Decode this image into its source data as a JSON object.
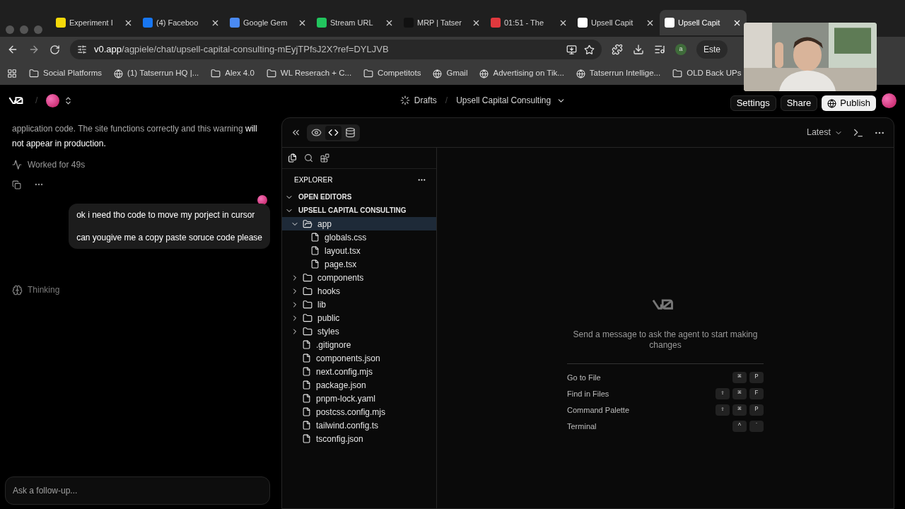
{
  "browser": {
    "tabs": [
      {
        "title": "Experiment I",
        "selected": false,
        "color": "#f5d90a"
      },
      {
        "title": "(4) Faceboo",
        "selected": false,
        "color": "#1877f2"
      },
      {
        "title": "Google Gem",
        "selected": false,
        "color": "#4a8af4"
      },
      {
        "title": "Stream URL",
        "selected": false,
        "color": "#22c55e"
      },
      {
        "title": "MRP | Tatser",
        "selected": false,
        "color": "#111111"
      },
      {
        "title": "01:51 - The",
        "selected": false,
        "color": "#e0393e"
      },
      {
        "title": "Upsell Capit",
        "selected": false,
        "color": "#ffffff"
      },
      {
        "title": "Upsell Capit",
        "selected": true,
        "color": "#ffffff"
      }
    ],
    "url_host": "v0.app",
    "url_path": "/agpiele/chat/upsell-capital-consulting-mEyjTPfsJ2X?ref=DYLJVB",
    "profile_initial": "a",
    "profile_label": "Este",
    "bookmarks": [
      {
        "label": "Social Platforms",
        "kind": "folder"
      },
      {
        "label": "(1) Tatserrun HQ |...",
        "kind": "page"
      },
      {
        "label": "Alex 4.0",
        "kind": "folder"
      },
      {
        "label": "WL Reserach + C...",
        "kind": "folder"
      },
      {
        "label": "Competitots",
        "kind": "folder"
      },
      {
        "label": "Gmail",
        "kind": "page"
      },
      {
        "label": "Advertising on Tik...",
        "kind": "page"
      },
      {
        "label": "Tatserrun Intellige...",
        "kind": "page"
      },
      {
        "label": "OLD Back UPs",
        "kind": "folder"
      }
    ]
  },
  "header": {
    "separators": [
      "/",
      "/"
    ],
    "drafts": "Drafts",
    "project": "Upsell Capital Consulting",
    "buttons": [
      {
        "label": "Settings",
        "kind": "plain"
      },
      {
        "label": "Share",
        "kind": "plain"
      },
      {
        "label": "Publish",
        "kind": "primary"
      }
    ]
  },
  "chat": {
    "reply_dim": "application code. The site functions correctly and this warning",
    "reply_bright": "will not appear in production.",
    "worked": "Worked for 49s",
    "user_lines": [
      "ok i need tho code to move my porject in cursor",
      "can yougive me a copy paste soruce code please"
    ],
    "status": "Thinking",
    "input_placeholder": "Ask a follow-up..."
  },
  "panel": {
    "version": "Latest",
    "views": [
      {
        "kind": "preview",
        "selected": false
      },
      {
        "kind": "code",
        "selected": true
      },
      {
        "kind": "database",
        "selected": false
      }
    ],
    "explorer_title": "EXPLORER",
    "tree": [
      {
        "label": "OPEN EDITORS",
        "kind": "section",
        "expanded": true
      },
      {
        "label": "UPSELL CAPITAL CONSULTING",
        "kind": "section",
        "expanded": true,
        "children": [
          {
            "label": "app",
            "kind": "folder",
            "expanded": true,
            "selected": true,
            "children": [
              {
                "label": "globals.css",
                "kind": "file",
                "selected": false
              },
              {
                "label": "layout.tsx",
                "kind": "file",
                "selected": false
              },
              {
                "label": "page.tsx",
                "kind": "file",
                "selected": false
              }
            ]
          },
          {
            "label": "components",
            "kind": "folder",
            "expanded": false,
            "selected": false
          },
          {
            "label": "hooks",
            "kind": "folder",
            "expanded": false,
            "selected": false
          },
          {
            "label": "lib",
            "kind": "folder",
            "expanded": false,
            "selected": false
          },
          {
            "label": "public",
            "kind": "folder",
            "expanded": false,
            "selected": false
          },
          {
            "label": "styles",
            "kind": "folder",
            "expanded": false,
            "selected": false
          },
          {
            "label": ".gitignore",
            "kind": "file",
            "selected": false
          },
          {
            "label": "components.json",
            "kind": "file",
            "selected": false
          },
          {
            "label": "next.config.mjs",
            "kind": "file",
            "selected": false
          },
          {
            "label": "package.json",
            "kind": "file",
            "selected": false
          },
          {
            "label": "pnpm-lock.yaml",
            "kind": "file",
            "selected": false
          },
          {
            "label": "postcss.config.mjs",
            "kind": "file",
            "selected": false
          },
          {
            "label": "tailwind.config.ts",
            "kind": "file",
            "selected": false
          },
          {
            "label": "tsconfig.json",
            "kind": "file",
            "selected": false
          }
        ]
      }
    ],
    "empty_message": "Send a message to ask the agent to start making changes",
    "shortcuts": [
      {
        "label": "Go to File",
        "keys": [
          "⌘",
          "P"
        ]
      },
      {
        "label": "Find in Files",
        "keys": [
          "⇧",
          "⌘",
          "F"
        ]
      },
      {
        "label": "Command Palette",
        "keys": [
          "⇧",
          "⌘",
          "P"
        ]
      },
      {
        "label": "Terminal",
        "keys": [
          "^",
          "`"
        ]
      }
    ]
  }
}
